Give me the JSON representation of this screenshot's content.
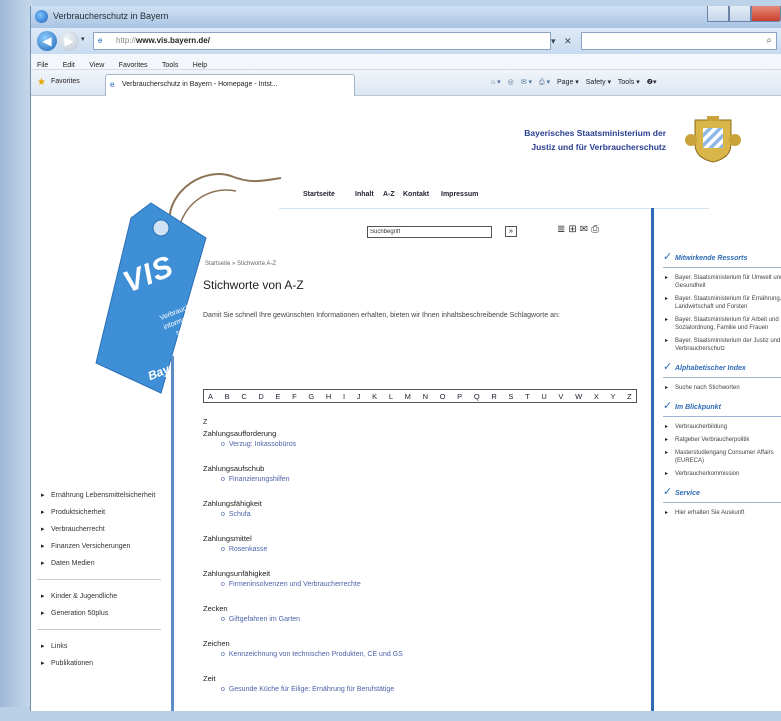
{
  "browser": {
    "window_title": "Verbraucherschutz in Bayern",
    "address_gray": "http://",
    "address_main": "www.vis.bayern.de/",
    "menu": [
      "File",
      "Edit",
      "View",
      "Favorites",
      "Tools",
      "Help"
    ],
    "favorites_label": "Favorites",
    "tab_title": "Verbraucherschutz in Bayern - Homepage - Intst...",
    "cmd_page": "Page ▾",
    "cmd_safety": "Safety ▾",
    "cmd_tools": "Tools ▾",
    "cmd_help": "❷▾"
  },
  "header": {
    "ministry_line1": "Bayerisches Staatsministerium der",
    "ministry_line2": "Justiz und für Verbraucherschutz"
  },
  "logo": {
    "vis": "VIS",
    "subtitle_line1": "Verbraucher-",
    "subtitle_line2": "informations-",
    "subtitle_line3": "system",
    "region": "Bayern"
  },
  "nav": {
    "items": [
      "Startseite",
      "Inhalt",
      "A-Z",
      "Kontakt",
      "Impressum"
    ]
  },
  "search": {
    "placeholder": "Suchbegriff",
    "go": "»"
  },
  "main": {
    "breadcrumb": "Startseite » Stichworte A-Z",
    "title": "Stichworte von A-Z",
    "intro": "Damit Sie schnell Ihre gewünschten Informationen erhalten, bieten wir Ihnen inhaltsbeschreibende Schlagworte an:",
    "alphabet": [
      "A",
      "B",
      "C",
      "D",
      "E",
      "F",
      "G",
      "H",
      "I",
      "J",
      "K",
      "L",
      "M",
      "N",
      "O",
      "P",
      "Q",
      "R",
      "S",
      "T",
      "U",
      "V",
      "W",
      "X",
      "Y",
      "Z"
    ],
    "current_letter": "Z",
    "entries": [
      {
        "word": "Zahlungsaufforderung",
        "link": "Verzug: Inkassobüros"
      },
      {
        "word": "Zahlungsaufschub",
        "link": "Finanzierungshilfen"
      },
      {
        "word": "Zahlungsfähigkeit",
        "link": "Schufa"
      },
      {
        "word": "Zahlungsmittel",
        "link": "Rosenkasse"
      },
      {
        "word": "Zahlungsunfähigkeit",
        "link": "Firmeninsolvenzen und Verbraucherrechte"
      },
      {
        "word": "Zecken",
        "link": "Giftgefahren im Garten"
      },
      {
        "word": "Zeichen",
        "link": "Kennzeichnung von technischen Produkten, CE und GS"
      },
      {
        "word": "Zeit",
        "link": "Gesunde Küche für Eilige: Ernährung für Berufstätige"
      }
    ]
  },
  "left_nav": {
    "group1": [
      "Ernährung Lebensmittelsicherheit",
      "Produktsicherheit",
      "Verbraucherrecht",
      "Finanzen Versicherungen",
      "Daten Medien"
    ],
    "group2": [
      "Kinder & Jugendliche",
      "Generation 50plus"
    ],
    "group3": [
      "Links",
      "Publikationen"
    ]
  },
  "right_nav": {
    "section1": {
      "title": "Mitwirkende Ressorts",
      "items": [
        "Bayer. Staatsministerium für Umwelt und Gesundheit",
        "Bayer. Staatsministerium für Ernährung, Landwirtschaft und Forsten",
        "Bayer. Staatsministerium für Arbeit und Sozialordnung, Familie und Frauen",
        "Bayer. Staatsministerium der Justiz und für Verbraucherschutz"
      ]
    },
    "section2": {
      "title": "Alphabetischer Index",
      "items": [
        "Suche nach Stichworten"
      ]
    },
    "section3": {
      "title": "Im Blickpunkt",
      "items": [
        "Verbraucherbildung",
        "Ratgeber Verbraucherpolitik",
        "Masterstudiengang Consumer Affairs (EURECA)",
        "Verbraucherkommission"
      ]
    },
    "section4": {
      "title": "Service",
      "items": [
        "Hier erhalten Sie Auskunft"
      ]
    }
  },
  "colors": {
    "accent_blue": "#2e6bb5",
    "link_blue": "#4d63a8",
    "tag_blue": "#3f8fd6"
  }
}
